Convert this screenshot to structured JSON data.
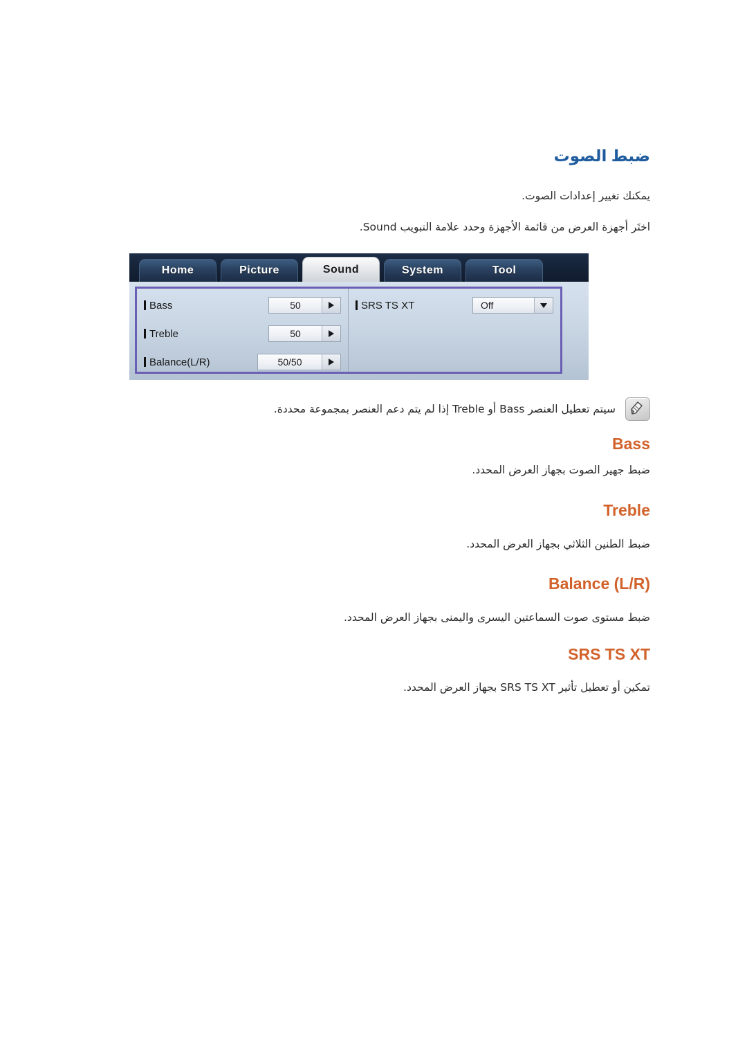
{
  "document": {
    "language": "ar",
    "direction": "rtl",
    "heading_color": "#1f5c9e",
    "section_color": "#d2622a"
  },
  "main_heading": "ضبط الصوت",
  "intro": {
    "line1": "يمكنك تغيير إعدادات الصوت.",
    "line2": "اختَر أجهزة العرض من قائمة الأجهزة وحدد علامة التبويب Sound."
  },
  "osd": {
    "tabs": [
      {
        "label": "Home",
        "active": false
      },
      {
        "label": "Picture",
        "active": false
      },
      {
        "label": "Sound",
        "active": true
      },
      {
        "label": "System",
        "active": false
      },
      {
        "label": "Tool",
        "active": false
      }
    ],
    "left_column": [
      {
        "label": "Bass",
        "value": "50",
        "control": "stepper-arrow-right"
      },
      {
        "label": "Treble",
        "value": "50",
        "control": "stepper-arrow-right"
      },
      {
        "label": "Balance(L/R)",
        "value": "50/50",
        "control": "stepper-arrow-right"
      }
    ],
    "right_column": [
      {
        "label": "SRS TS XT",
        "value": "Off",
        "control": "dropdown-arrow-down"
      }
    ],
    "focus_border_color": "#6b5fb5",
    "tabbar_color": "#16243a",
    "body_color": "#c9d6e4"
  },
  "note": {
    "icon": "note-pencil-icon",
    "text": "سيتم تعطيل العنصر Bass أو Treble إذا لم يتم دعم العنصر بمجموعة محددة."
  },
  "sections": [
    {
      "title": "Bass",
      "description": "ضبط جهير الصوت بجهاز العرض المحدد."
    },
    {
      "title": "Treble",
      "description": "ضبط الطنين الثلاثي بجهاز العرض المحدد."
    },
    {
      "title": "Balance (L/R)",
      "description": "ضبط مستوى صوت السماعتين اليسرى واليمنى بجهاز العرض المحدد."
    },
    {
      "title": "SRS TS XT",
      "description": "تمكين أو تعطيل تأثير SRS TS XT بجهاز العرض المحدد."
    }
  ]
}
